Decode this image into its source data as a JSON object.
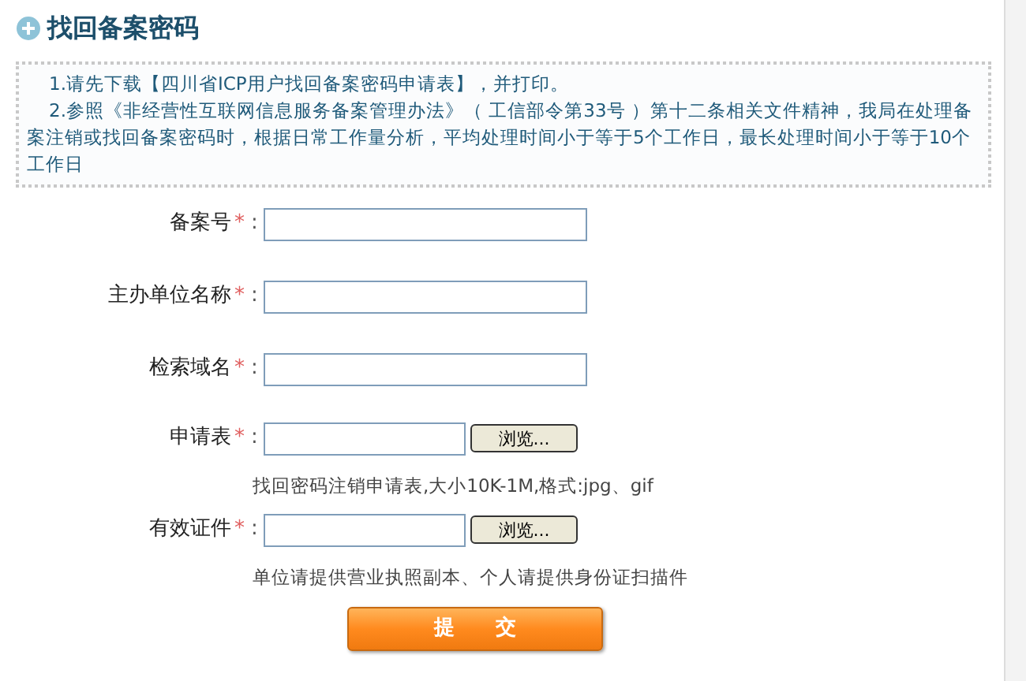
{
  "title": "找回备案密码",
  "notice": [
    "1.请先下载【四川省ICP用户找回备案密码申请表】，并打印。",
    "2.参照《非经营性互联网信息服务备案管理办法》（ 工信部令第33号 ）第十二条相关文件精神，我局在处理备案注销或找回备案密码时，根据日常工作量分析，平均处理时间小于等于5个工作日，最长处理时间小于等于10个工作日"
  ],
  "fields": [
    {
      "kind": "text",
      "label": "备案号",
      "required": "*",
      "colon": ":"
    },
    {
      "kind": "text",
      "label": "主办单位名称",
      "required": "*",
      "colon": ":"
    },
    {
      "kind": "text",
      "label": "检索域名",
      "required": "*",
      "colon": ":"
    },
    {
      "kind": "file",
      "label": "申请表",
      "required": "*",
      "colon": ":",
      "browse": "浏览...",
      "hint": "找回密码注销申请表,大小10K-1M,格式:jpg、gif"
    },
    {
      "kind": "file",
      "label": "有效证件",
      "required": "*",
      "colon": ":",
      "browse": "浏览...",
      "hint": "单位请提供营业执照副本、个人请提供身份证扫描件"
    }
  ],
  "submit": "提　　交"
}
